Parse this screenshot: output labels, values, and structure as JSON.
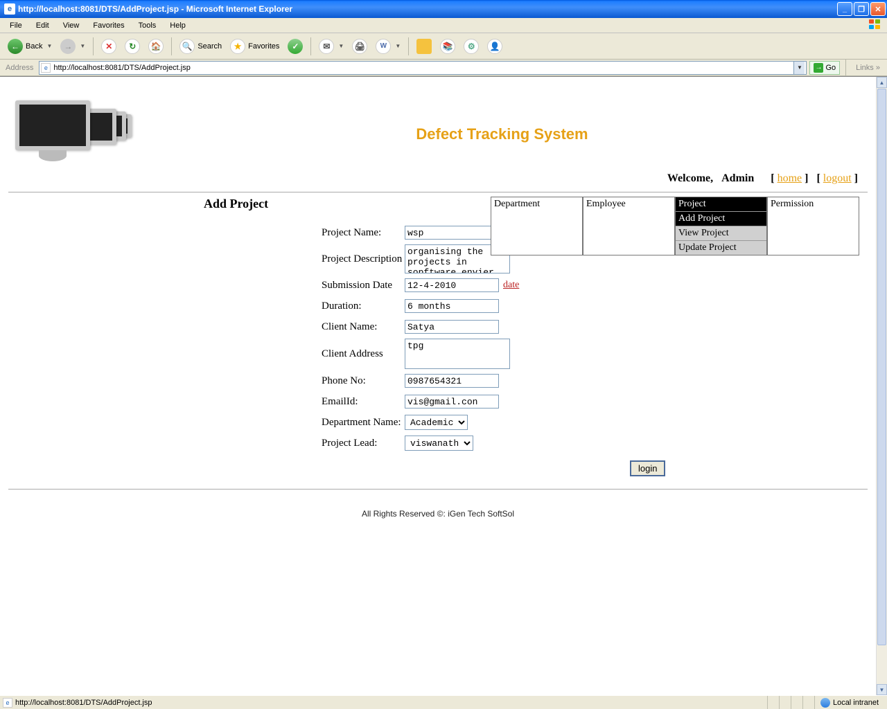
{
  "window": {
    "title": "http://localhost:8081/DTS/AddProject.jsp - Microsoft Internet Explorer"
  },
  "menu": {
    "file": "File",
    "edit": "Edit",
    "view": "View",
    "favorites": "Favorites",
    "tools": "Tools",
    "help": "Help"
  },
  "toolbar": {
    "back": "Back",
    "search": "Search",
    "favorites": "Favorites"
  },
  "addressbar": {
    "label": "Address",
    "url": "http://localhost:8081/DTS/AddProject.jsp",
    "go": "Go",
    "links": "Links"
  },
  "app": {
    "title": "Defect Tracking System",
    "welcome": "Welcome,",
    "user": "Admin",
    "home": "home",
    "logout": "logout"
  },
  "nav": {
    "department": "Department",
    "employee": "Employee",
    "project": "Project",
    "permission": "Permission",
    "add_project": "Add Project",
    "view_project": "View Project",
    "update_project": "Update Project"
  },
  "form": {
    "heading": "Add Project",
    "labels": {
      "project_name": "Project Name:",
      "project_desc": "Project Description",
      "submission_date": "Submission Date",
      "duration": "Duration:",
      "client_name": "Client Name:",
      "client_address": "Client Address",
      "phone": "Phone No:",
      "email": "EmailId:",
      "dept_name": "Department Name:",
      "project_lead": "Project Lead:"
    },
    "values": {
      "project_name": "wsp",
      "project_desc": "organising the projects in sopftware envier",
      "submission_date": "12-4-2010",
      "duration": "6 months",
      "client_name": "Satya",
      "client_address": "tpg",
      "phone": "0987654321",
      "email": "vis@gmail.con",
      "dept_name": "Academic",
      "project_lead": "viswanath"
    },
    "date_link": "date",
    "submit": "login"
  },
  "footer": "All Rights Reserved ©: iGen Tech SoftSol",
  "status": {
    "text": "http://localhost:8081/DTS/AddProject.jsp",
    "zone": "Local intranet"
  }
}
